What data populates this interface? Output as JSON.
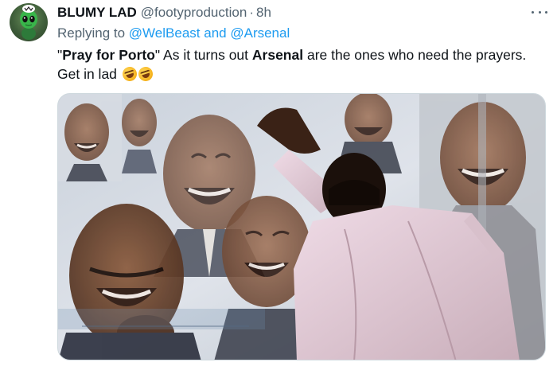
{
  "tweet": {
    "author": {
      "name": "BLUMY LAD",
      "handle": "@footyproduction",
      "separator": "·",
      "time": "8h",
      "avatar_icon": "alien-avatar-icon"
    },
    "reply": {
      "prefix": "Replying to",
      "mention_1": "@WelBeast",
      "conjunction": "and",
      "mention_2": "@Arsenal"
    },
    "text": {
      "quote_open": "\"",
      "bold_1": "Pray for Porto",
      "quote_close": "\"",
      "part_2": " As it turns out ",
      "bold_2": "Arsenal",
      "part_3": " are the ones who need the prayers. Get in lad",
      "emojis": [
        "rolling-on-floor-laughing-emoji",
        "rolling-on-floor-laughing-emoji"
      ]
    },
    "media": {
      "kind": "collage of a laughing man in a suit, layered faces, one figure leaning on a wall"
    },
    "more_icon": "more-options-icon"
  },
  "colors": {
    "text_primary": "#0f1419",
    "text_secondary": "#536471",
    "link": "#1d9bf0",
    "border": "#cfd9de"
  }
}
